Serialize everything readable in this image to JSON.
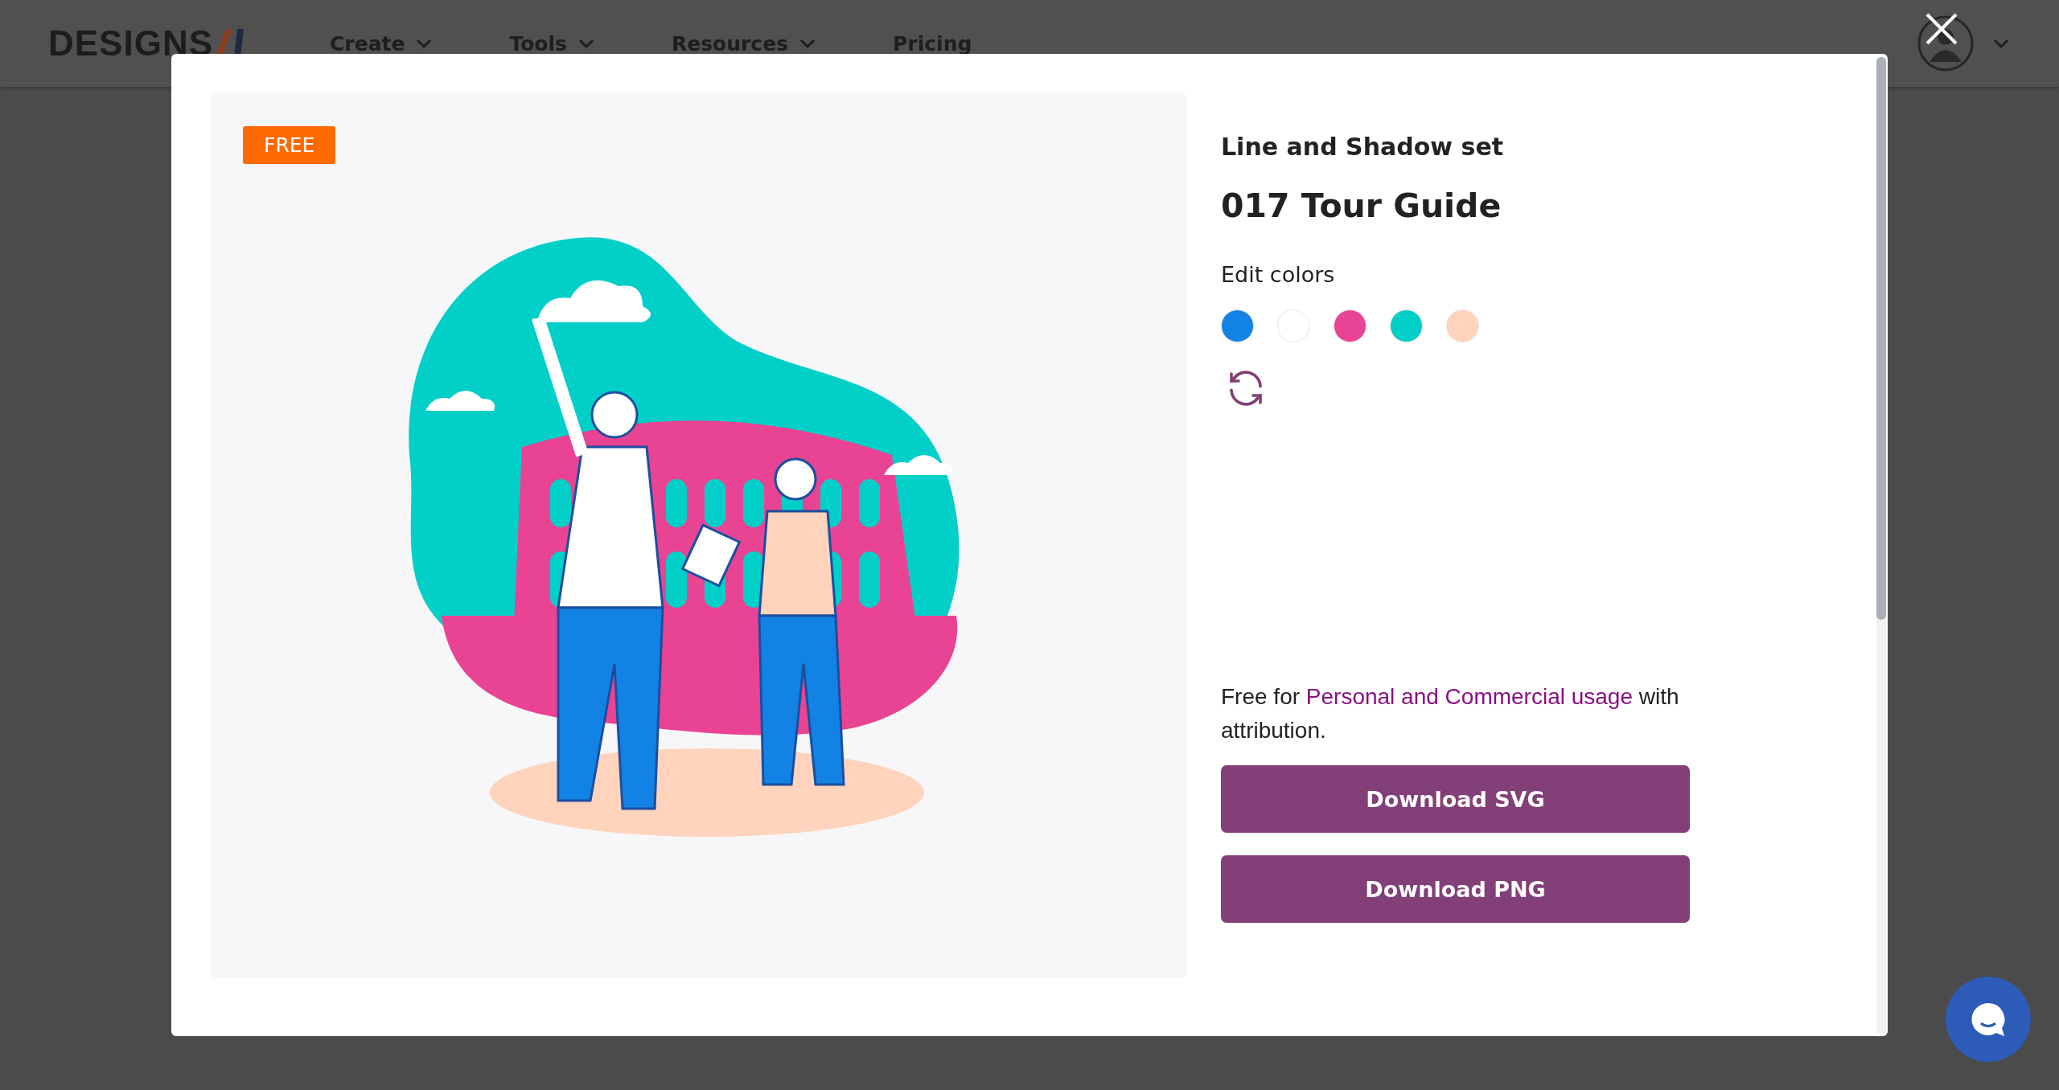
{
  "header": {
    "logo": "DESIGNS",
    "nav": [
      {
        "label": "Create",
        "dropdown": true
      },
      {
        "label": "Tools",
        "dropdown": true
      },
      {
        "label": "Resources",
        "dropdown": true
      },
      {
        "label": "Pricing",
        "dropdown": false
      }
    ]
  },
  "modal": {
    "badge": "FREE",
    "set_name": "Line and Shadow set",
    "title": "017 Tour Guide",
    "edit_colors_label": "Edit colors",
    "swatches": [
      {
        "color": "#1283e5"
      },
      {
        "color": "#ffffff"
      },
      {
        "color": "#e94393"
      },
      {
        "color": "#03cfc9"
      },
      {
        "color": "#ffd3bc"
      }
    ],
    "license": {
      "before": "Free for",
      "link": "Personal and Commercial usage",
      "after": "with attribution."
    },
    "buttons": [
      "Download SVG",
      "Download PNG"
    ]
  }
}
